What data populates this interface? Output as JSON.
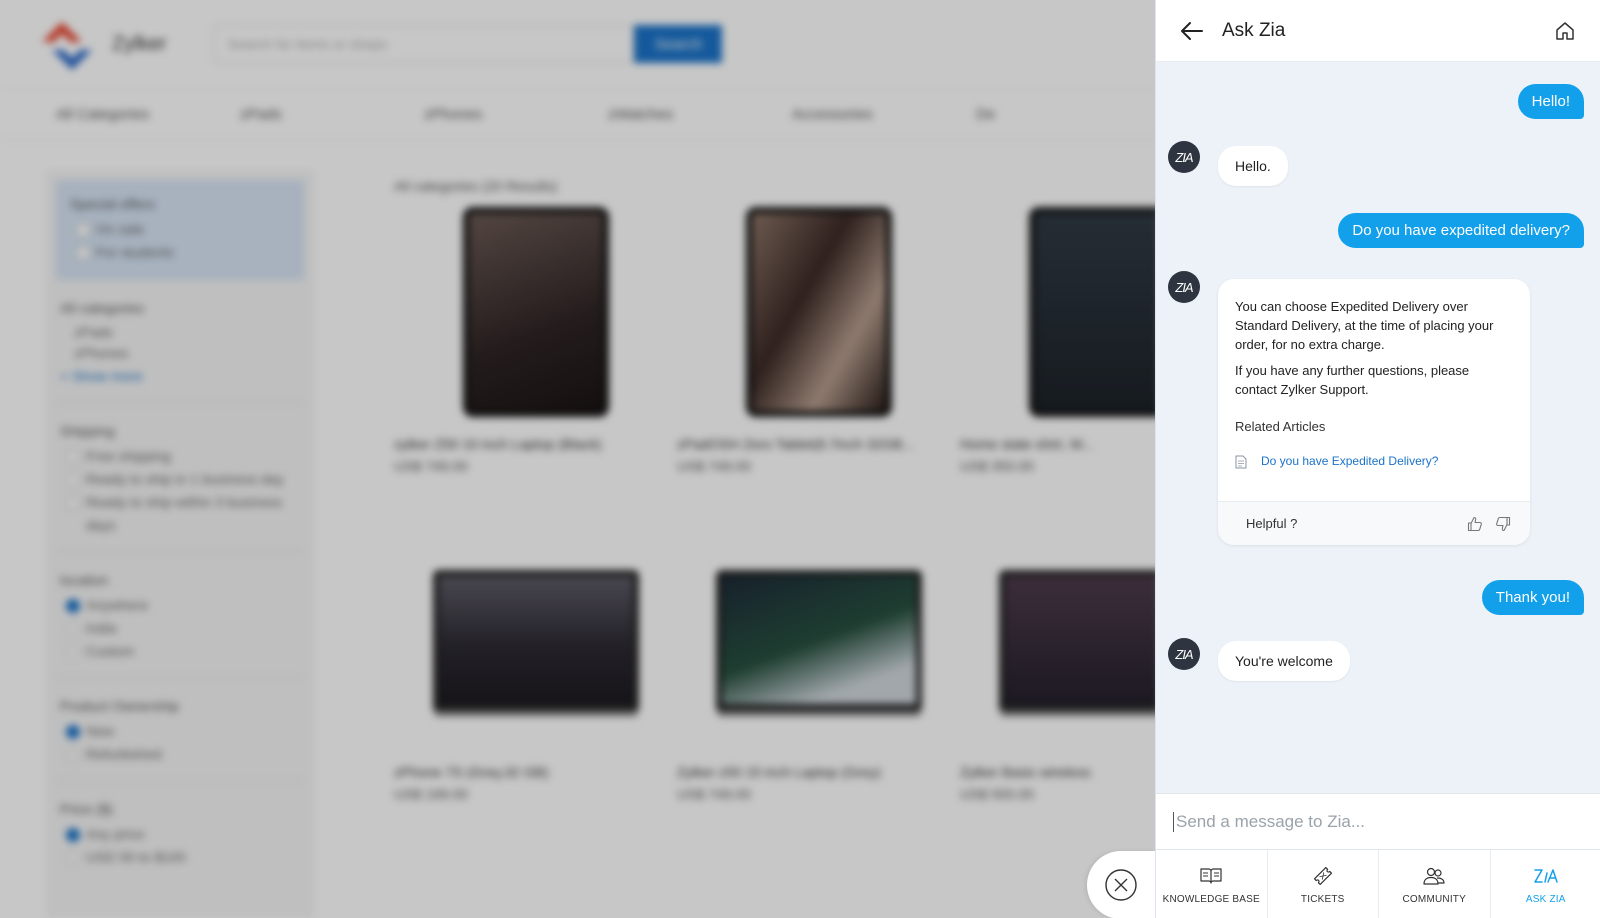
{
  "store": {
    "brand": "Zylker",
    "search_placeholder": "Search for items or shops",
    "search_button": "Search",
    "nav": [
      "All Categories",
      "zPads",
      "zPhones",
      "zWatches",
      "Accessories",
      "De"
    ],
    "filters": {
      "special_offers": {
        "title": "Special offers",
        "options": [
          "On sale",
          "For students"
        ]
      },
      "categories": {
        "title": "All categories",
        "options": [
          "zPads",
          "zPhones"
        ],
        "more": "+ Show more"
      },
      "shipping": {
        "title": "Shipping",
        "options": [
          "Free shipping",
          "Ready to ship in 1 business day",
          "Ready to ship within 3 business days"
        ]
      },
      "location": {
        "title": "location",
        "options": [
          "Anywhere",
          "India",
          "Custom"
        ]
      },
      "ownership": {
        "title": "Product Ownership",
        "options": [
          "New",
          "Refurbished"
        ]
      },
      "price": {
        "title": "Price ($)",
        "options": [
          "Any price",
          "USD 50 to $100"
        ]
      }
    },
    "results_label": "All categories (20 Results)",
    "products": [
      {
        "name": "zylker Z50 10 inch Laptop (Black)",
        "price": "US$ 749.00"
      },
      {
        "name": "zPadOSH Zero Tablet(8.7inch 32GB...",
        "price": "US$ 749.00"
      },
      {
        "name": "Home state shirt, W...",
        "price": "US$ 350.00"
      },
      {
        "name": "zPhone 7S (Grey,32 GB)",
        "price": "US$ 199.00"
      },
      {
        "name": "Zylker z50 15 inch Laptop (Grey)",
        "price": "US$ 749.00"
      },
      {
        "name": "Zylker Basic wireless",
        "price": "US$ 500.00"
      }
    ]
  },
  "panel": {
    "title": "Ask Zia",
    "avatar_text": "ZIA",
    "messages": {
      "out1": "Hello!",
      "in1": "Hello.",
      "out2": "Do you have expedited delivery?",
      "in2_p1": "You can choose Expedited Delivery over Standard Delivery, at the time of placing your order, for no extra charge.",
      "in2_p2": "If you have any further questions, please contact Zylker Support.",
      "related_title": "Related Articles",
      "related_link": "Do you have Expedited Delivery?",
      "helpful": "Helpful ?",
      "out3": "Thank you!",
      "in3": "You're welcome"
    },
    "composer_placeholder": "Send a message to Zia...",
    "tabs": [
      {
        "label": "KNOWLEDGE BASE",
        "icon": "book-icon"
      },
      {
        "label": "TICKETS",
        "icon": "ticket-icon"
      },
      {
        "label": "COMMUNITY",
        "icon": "community-icon"
      },
      {
        "label": "ASK ZIA",
        "icon": "zia-icon"
      }
    ],
    "accent_color": "#13a0ea",
    "chat_bg": "#ecf2f8"
  }
}
